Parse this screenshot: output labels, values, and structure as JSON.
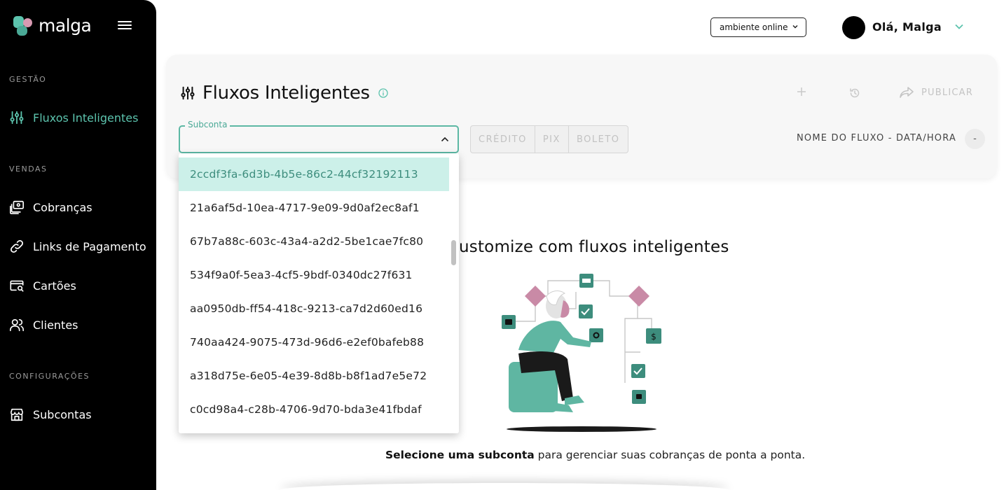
{
  "brand": {
    "name": "malga"
  },
  "sidebar": {
    "sections": [
      {
        "label": "GESTÃO",
        "items": [
          {
            "label": "Fluxos Inteligentes",
            "icon": "sliders-icon",
            "active": true
          }
        ]
      },
      {
        "label": "VENDAS",
        "items": [
          {
            "label": "Cobranças",
            "icon": "charges-icon"
          },
          {
            "label": "Links de Pagamento",
            "icon": "link-icon"
          },
          {
            "label": "Cartões",
            "icon": "card-search-icon"
          },
          {
            "label": "Clientes",
            "icon": "users-icon"
          }
        ]
      },
      {
        "label": "CONFIGURAÇÕES",
        "items": [
          {
            "label": "Subcontas",
            "icon": "store-icon"
          }
        ]
      }
    ]
  },
  "topbar": {
    "environment": "ambiente online",
    "greeting": "Olá, Malga"
  },
  "card": {
    "title": "Fluxos Inteligentes",
    "publish_label": "PUBLICAR",
    "subconta_label": "Subconta",
    "payment_tabs": [
      "CRÉDITO",
      "PIX",
      "BOLETO"
    ],
    "flow_name": "NOME DO FLUXO - DATA/HORA",
    "flow_badge": "-"
  },
  "dropdown": {
    "options": [
      "2ccdf3fa-6d3b-4b5e-86c2-44cf32192113",
      "21a6af5d-10ea-4717-9e09-9d0af2ec8af1",
      "67b7a88c-603c-43a4-a2d2-5be1cae7fc80",
      "534f9a0f-5ea3-4cf5-9bdf-0340dc27f631",
      "aa0950db-ff54-418c-9213-ca7d2d60ed16",
      "740aa424-9075-473d-96d6-e2ef0bafeb88",
      "a318d75e-6e05-4e39-8d8b-b8f1ad7e5e72",
      "c0cd98a4-c28b-4706-9d70-bda3e41fbdaf"
    ],
    "highlighted_index": 0
  },
  "main": {
    "headline": "ustomize com fluxos inteligentes",
    "footer_bold": "Selecione uma subconta",
    "footer_rest": " para gerenciar suas cobranças de ponta a ponta."
  },
  "colors": {
    "accent": "#5cc3ad",
    "highlight": "#ccf0e9",
    "diamond": "#c98aa6",
    "node": "#3d8d7d"
  }
}
